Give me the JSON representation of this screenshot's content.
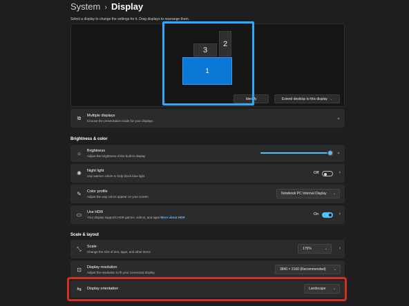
{
  "breadcrumb": {
    "parent": "System",
    "separator": "›",
    "current": "Display"
  },
  "arrange_hint": "Select a display to change the settings for it. Drag displays to rearrange them.",
  "monitors": [
    {
      "number": "1",
      "selected": true
    },
    {
      "number": "2",
      "selected": false
    },
    {
      "number": "3",
      "selected": false
    }
  ],
  "actions": {
    "identify": "Identify",
    "extend": "Extend desktop to this display"
  },
  "multiple_displays": {
    "title": "Multiple displays",
    "subtitle": "Choose the presentation mode for your displays"
  },
  "sections": {
    "brightness_color": "Brightness & color",
    "scale_layout": "Scale & layout"
  },
  "brightness": {
    "title": "Brightness",
    "subtitle": "Adjust the brightness of the built-in display",
    "level_percent": 100
  },
  "night_light": {
    "title": "Night light",
    "subtitle": "Use warmer colors to help block blue light",
    "state": "Off"
  },
  "color_profile": {
    "title": "Color profile",
    "subtitle": "Adjust the way colors appear on your screen",
    "value": "Notebook PC Internal Display"
  },
  "hdr": {
    "title": "Use HDR",
    "subtitle": "Your display supports HDR games, videos, and apps",
    "link": "More about HDR",
    "state": "On"
  },
  "scale": {
    "title": "Scale",
    "subtitle": "Change the size of text, apps, and other items",
    "value": "175%"
  },
  "resolution": {
    "title": "Display resolution",
    "subtitle": "Adjust the resolution to fit your connected display",
    "value": "3840 × 2160 (Recommended)"
  },
  "orientation": {
    "title": "Display orientation",
    "value": "Landscape"
  },
  "colors": {
    "accent": "#4cc2ff",
    "selected_monitor": "#0b78d7",
    "highlight_blue": "#2ea8ff",
    "highlight_red": "#d0321e"
  }
}
